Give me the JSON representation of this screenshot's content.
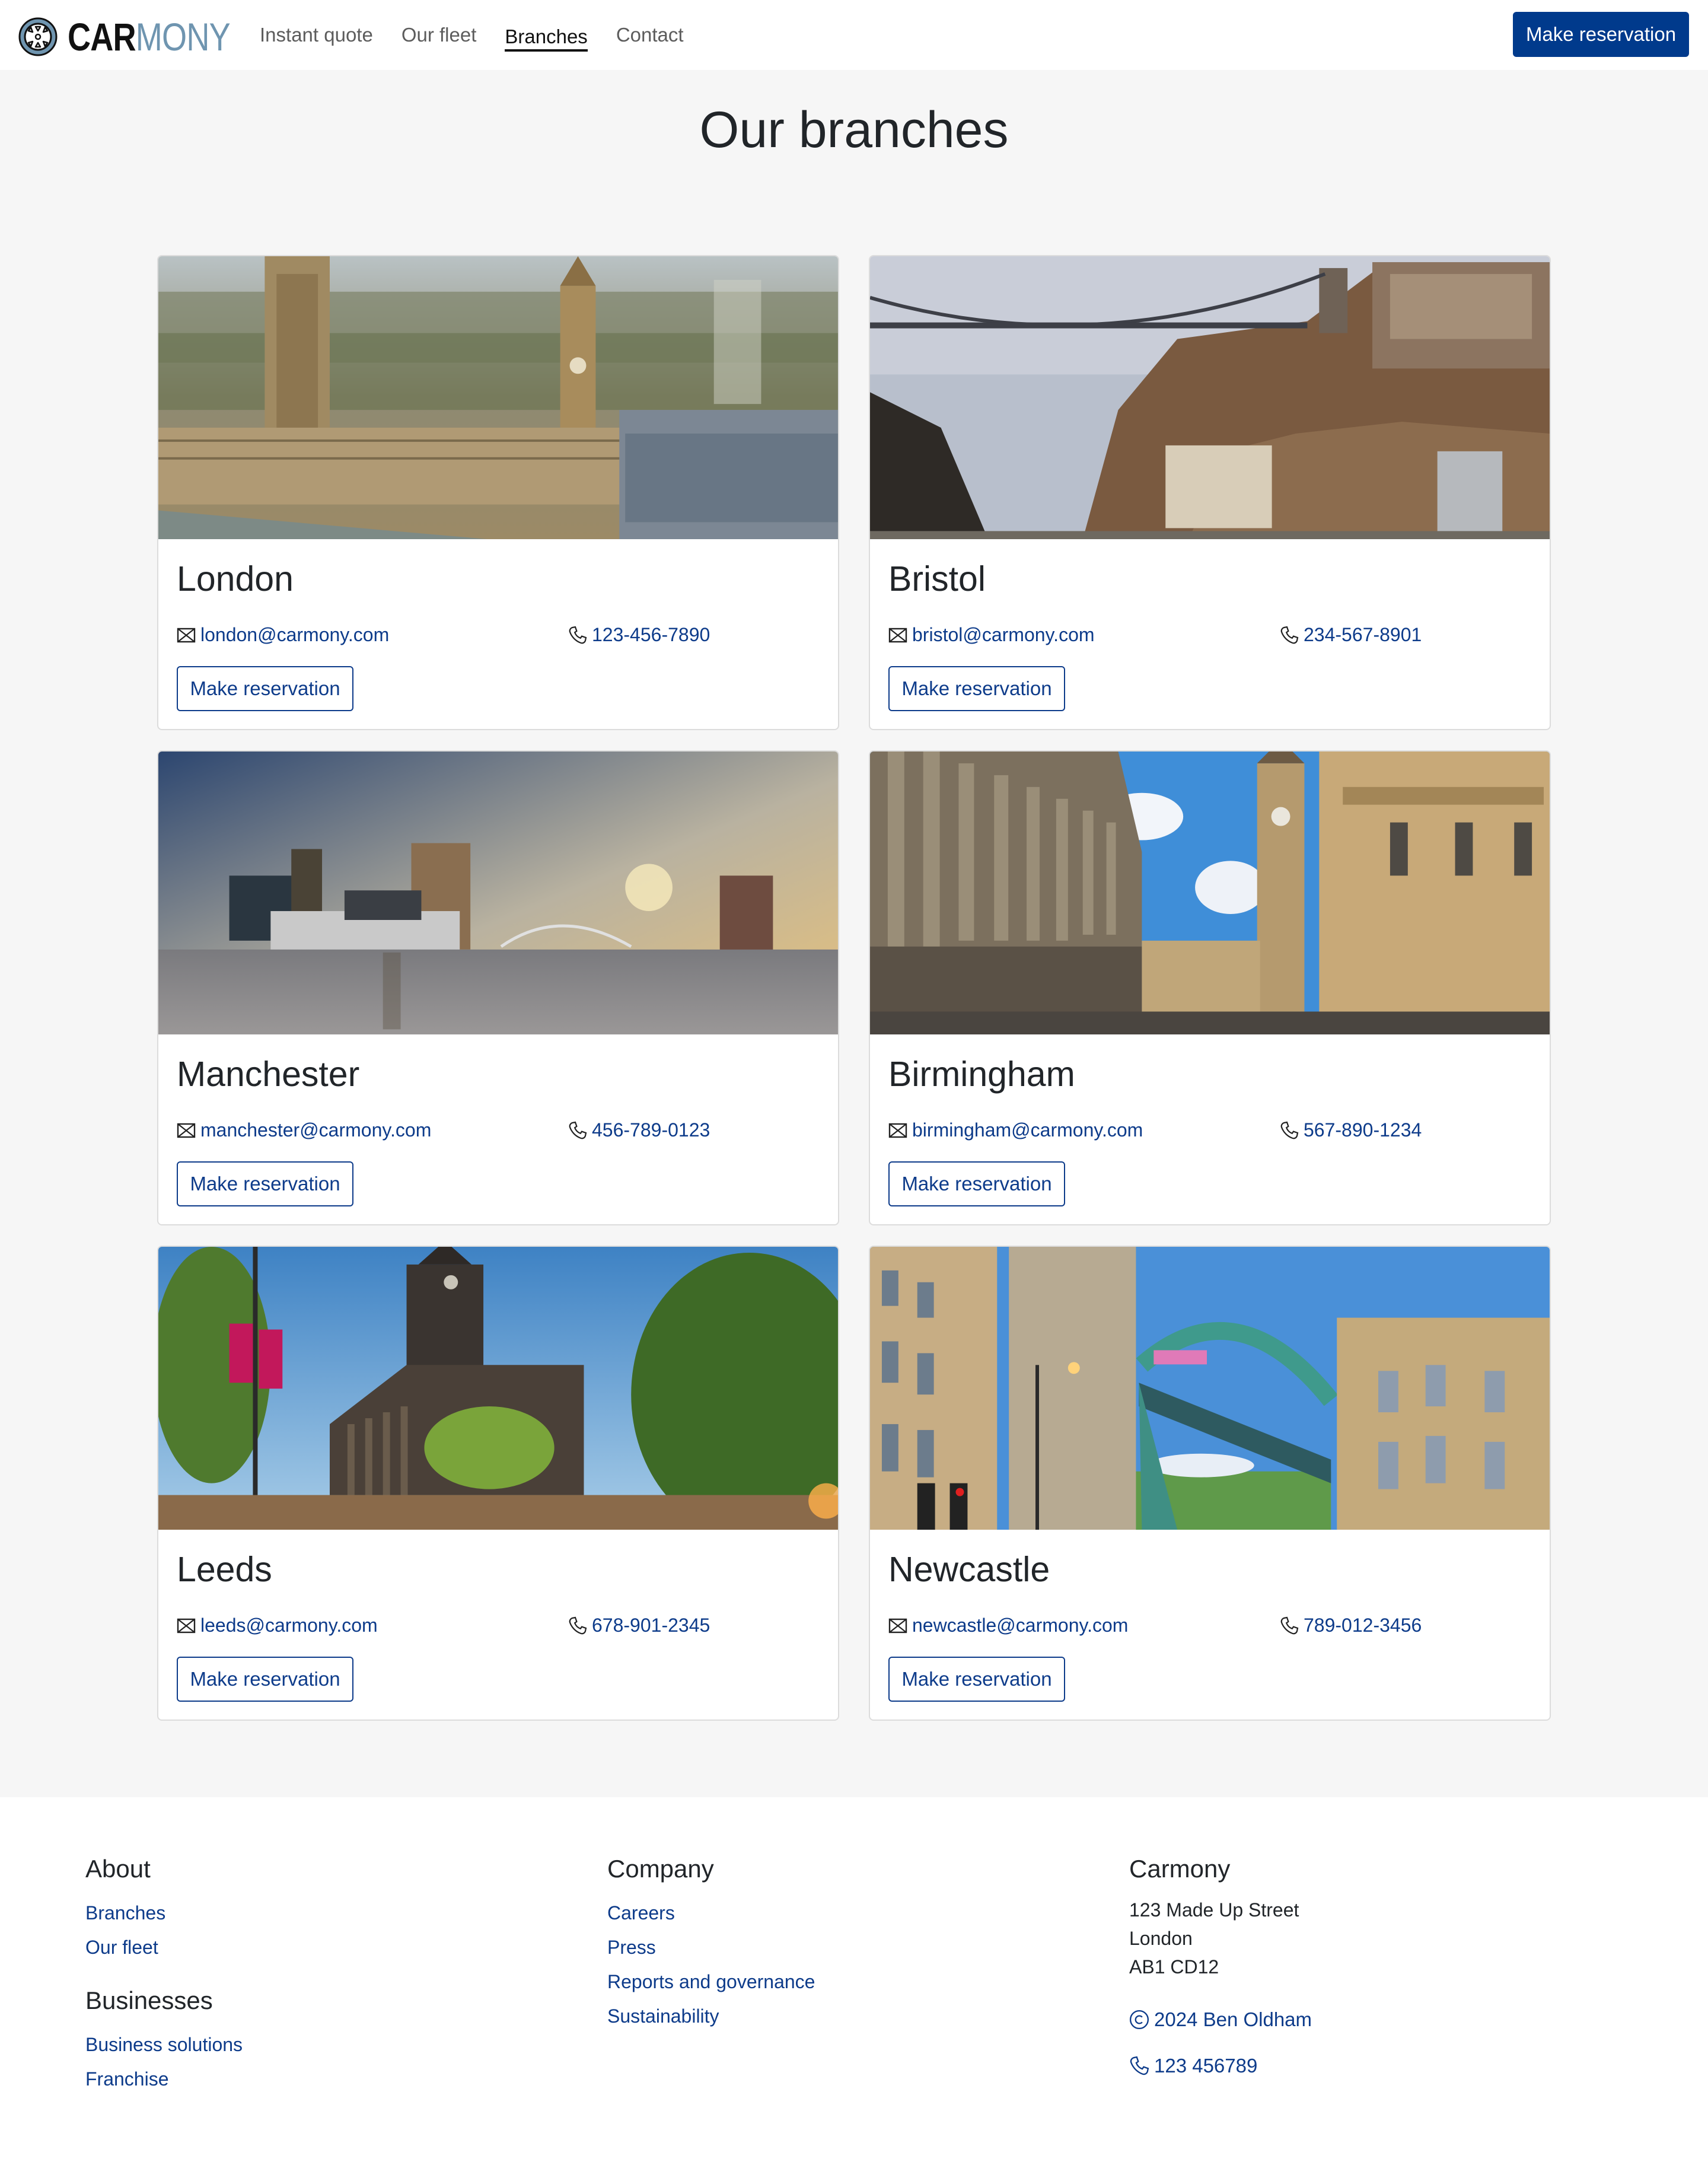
{
  "nav": {
    "brand_part1": "CAR",
    "brand_part2": "MONY",
    "links": [
      {
        "label": "Instant quote",
        "active": false
      },
      {
        "label": "Our fleet",
        "active": false
      },
      {
        "label": "Branches",
        "active": true
      },
      {
        "label": "Contact",
        "active": false
      }
    ],
    "cta_label": "Make reservation"
  },
  "colors": {
    "primary": "#003a8c",
    "link": "#0d3b8a",
    "logo_accent": "#6f95b0",
    "page_bg": "#f6f6f6"
  },
  "page": {
    "title": "Our branches"
  },
  "branches": [
    {
      "name": "London",
      "email": "london@carmony.com",
      "phone": "123-456-7890",
      "button_label": "Make reservation",
      "image": "Houses of Parliament and Big Ben aerial view"
    },
    {
      "name": "Bristol",
      "email": "bristol@carmony.com",
      "phone": "234-567-8901",
      "button_label": "Make reservation",
      "image": "Clifton Suspension Bridge over Avon Gorge"
    },
    {
      "name": "Manchester",
      "email": "manchester@carmony.com",
      "phone": "456-789-0123",
      "button_label": "Make reservation",
      "image": "Salford Quays waterfront at sunset"
    },
    {
      "name": "Birmingham",
      "email": "birmingham@carmony.com",
      "phone": "567-890-1234",
      "button_label": "Make reservation",
      "image": "Victoria Square with town hall columns and clock tower"
    },
    {
      "name": "Leeds",
      "email": "leeds@carmony.com",
      "phone": "678-901-2345",
      "button_label": "Make reservation",
      "image": "Leeds Town Hall with trees and street lamp"
    },
    {
      "name": "Newcastle",
      "email": "newcastle@carmony.com",
      "phone": "789-012-3456",
      "button_label": "Make reservation",
      "image": "Tyne Bridge between stone buildings"
    }
  ],
  "footer": {
    "about": {
      "heading": "About",
      "links": [
        "Branches",
        "Our fleet"
      ]
    },
    "businesses": {
      "heading": "Businesses",
      "links": [
        "Business solutions",
        "Franchise"
      ]
    },
    "company": {
      "heading": "Company",
      "links": [
        "Careers",
        "Press",
        "Reports and governance",
        "Sustainability"
      ]
    },
    "carmony": {
      "heading": "Carmony",
      "address_lines": [
        "123 Made Up Street",
        "London",
        "AB1 CD12"
      ],
      "copyright": "2024 Ben Oldham",
      "phone": "123 456789"
    }
  }
}
